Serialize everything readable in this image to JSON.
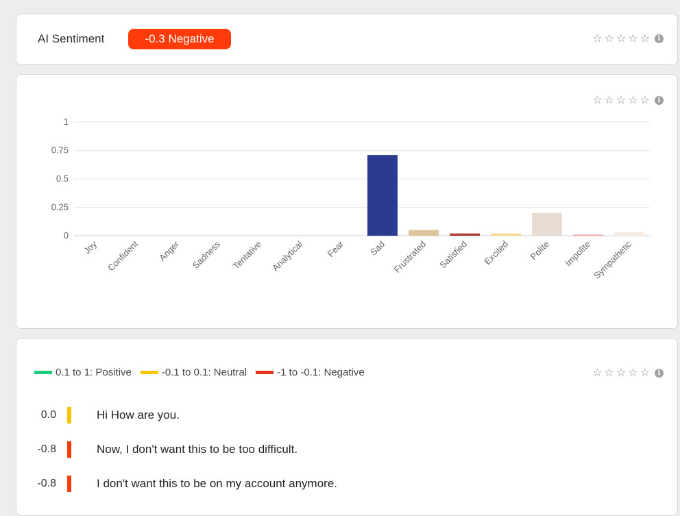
{
  "sentiment_card": {
    "label": "AI Sentiment",
    "badge": "-0.3 Negative",
    "badge_color": "#ff3b0a"
  },
  "icons": {
    "star": "star-outline-icon",
    "info": "info-icon",
    "star_count": 5
  },
  "chart_data": {
    "type": "bar",
    "categories": [
      "Joy",
      "Confident",
      "Anger",
      "Sadness",
      "Tentative",
      "Analytical",
      "Fear",
      "Sad",
      "Frustrated",
      "Satisfied",
      "Excited",
      "Polite",
      "Impolite",
      "Sympathetic"
    ],
    "values": [
      0,
      0,
      0,
      0,
      0,
      0,
      0,
      0.71,
      0.05,
      0.02,
      0.02,
      0.2,
      0.01,
      0.03
    ],
    "colors": [
      "#cccccc",
      "#cccccc",
      "#cccccc",
      "#cccccc",
      "#cccccc",
      "#cccccc",
      "#cccccc",
      "#2b3b91",
      "#dcc59a",
      "#b23a32",
      "#f5d98e",
      "#e8dcd3",
      "#f5a7a7",
      "#f8ece0"
    ],
    "ylim": [
      0,
      1
    ],
    "yticks": [
      0,
      0.25,
      0.5,
      0.75,
      1
    ],
    "ytick_labels": [
      "0",
      "0.25",
      "0.5",
      "0.75",
      "1"
    ],
    "grid": true,
    "title": "",
    "xlabel": "",
    "ylabel": ""
  },
  "legend": [
    {
      "label": "0.1 to 1: Positive",
      "color": "#1fcc7a"
    },
    {
      "label": "-0.1 to 0.1: Neutral",
      "color": "#f7c600"
    },
    {
      "label": "-1 to -0.1: Negative",
      "color": "#e0331d"
    }
  ],
  "lines": [
    {
      "score": "0.0",
      "text": "Hi How are you.",
      "color": "#f7c600"
    },
    {
      "score": "-0.8",
      "text": "Now, I don't want this to be too difficult.",
      "color": "#ff3b0a"
    },
    {
      "score": "-0.8",
      "text": "I don't want this to be on my account anymore.",
      "color": "#ff3b0a"
    }
  ]
}
